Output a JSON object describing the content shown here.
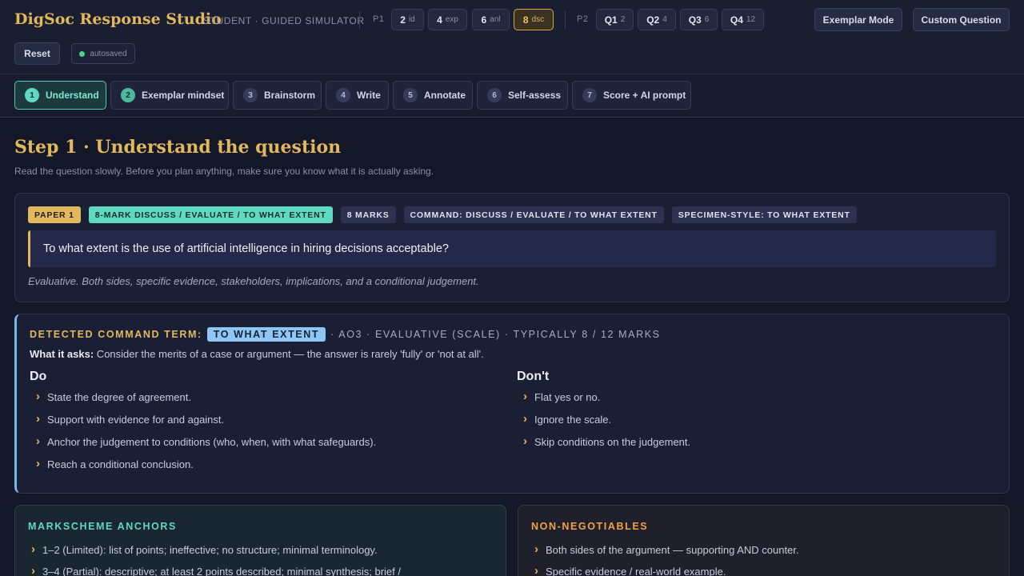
{
  "app": {
    "title": "DigSoc Response Studio",
    "subtitle": "STUDENT · GUIDED SIMULATOR"
  },
  "paper1": {
    "label": "P1",
    "chips": [
      {
        "main": "2",
        "sub": "id"
      },
      {
        "main": "4",
        "sub": "exp"
      },
      {
        "main": "6",
        "sub": "anl"
      },
      {
        "main": "8",
        "sub": "dsc",
        "active": true
      }
    ]
  },
  "paper2": {
    "label": "P2",
    "chips": [
      {
        "main": "Q1",
        "sub": "2"
      },
      {
        "main": "Q2",
        "sub": "4"
      },
      {
        "main": "Q3",
        "sub": "6"
      },
      {
        "main": "Q4",
        "sub": "12"
      }
    ]
  },
  "header_buttons": {
    "exemplar": "Exemplar Mode",
    "custom": "Custom Question",
    "reset": "Reset",
    "autosaved": "autosaved"
  },
  "steps": [
    {
      "num": "1",
      "label": "Understand",
      "state": "active"
    },
    {
      "num": "2",
      "label": "Exemplar mindset",
      "state": "done"
    },
    {
      "num": "3",
      "label": "Brainstorm"
    },
    {
      "num": "4",
      "label": "Write"
    },
    {
      "num": "5",
      "label": "Annotate"
    },
    {
      "num": "6",
      "label": "Self-assess"
    },
    {
      "num": "7",
      "label": "Score + AI prompt"
    }
  ],
  "page": {
    "title": "Step 1 · Understand the question",
    "lead": "Read the question slowly. Before you plan anything, make sure you know what it is actually asking."
  },
  "question": {
    "tags": [
      "PAPER 1",
      "8-MARK DISCUSS / EVALUATE / TO WHAT EXTENT",
      "8 MARKS",
      "COMMAND: DISCUSS / EVALUATE / TO WHAT EXTENT",
      "SPECIMEN-STYLE: TO WHAT EXTENT"
    ],
    "text": "To what extent is the use of artificial intelligence in hiring decisions acceptable?",
    "note": "Evaluative. Both sides, specific evidence, stakeholders, implications, and a conditional judgement."
  },
  "command": {
    "label": "DETECTED COMMAND TERM:",
    "term": "TO WHAT EXTENT",
    "rest": "· AO3 · EVALUATIVE (SCALE) · TYPICALLY 8 / 12 MARKS",
    "asks_label": "What it asks:",
    "asks_text": " Consider the merits of a case or argument — the answer is rarely 'fully' or 'not at all'.",
    "do_title": "Do",
    "do": [
      "State the degree of agreement.",
      "Support with evidence for and against.",
      "Anchor the judgement to conditions (who, when, with what safeguards).",
      "Reach a conditional conclusion."
    ],
    "dont_title": "Don't",
    "dont": [
      "Flat yes or no.",
      "Ignore the scale.",
      "Skip conditions on the judgement."
    ]
  },
  "anchors": {
    "title": "MARKSCHEME ANCHORS",
    "items": [
      "1–2 (Limited): list of points; ineffective; no structure; minimal terminology.",
      "3–4 (Partial): descriptive; at least 2 points described; minimal synthesis; brief /"
    ]
  },
  "nonneg": {
    "title": "NON-NEGOTIABLES",
    "items": [
      "Both sides of the argument — supporting AND counter.",
      "Specific evidence / real-world example."
    ]
  },
  "colors": {
    "gold": "#e2b85c",
    "teal": "#5fd9c2",
    "blue": "#8fc6f6",
    "orange": "#f0a244",
    "background": "#131727"
  }
}
